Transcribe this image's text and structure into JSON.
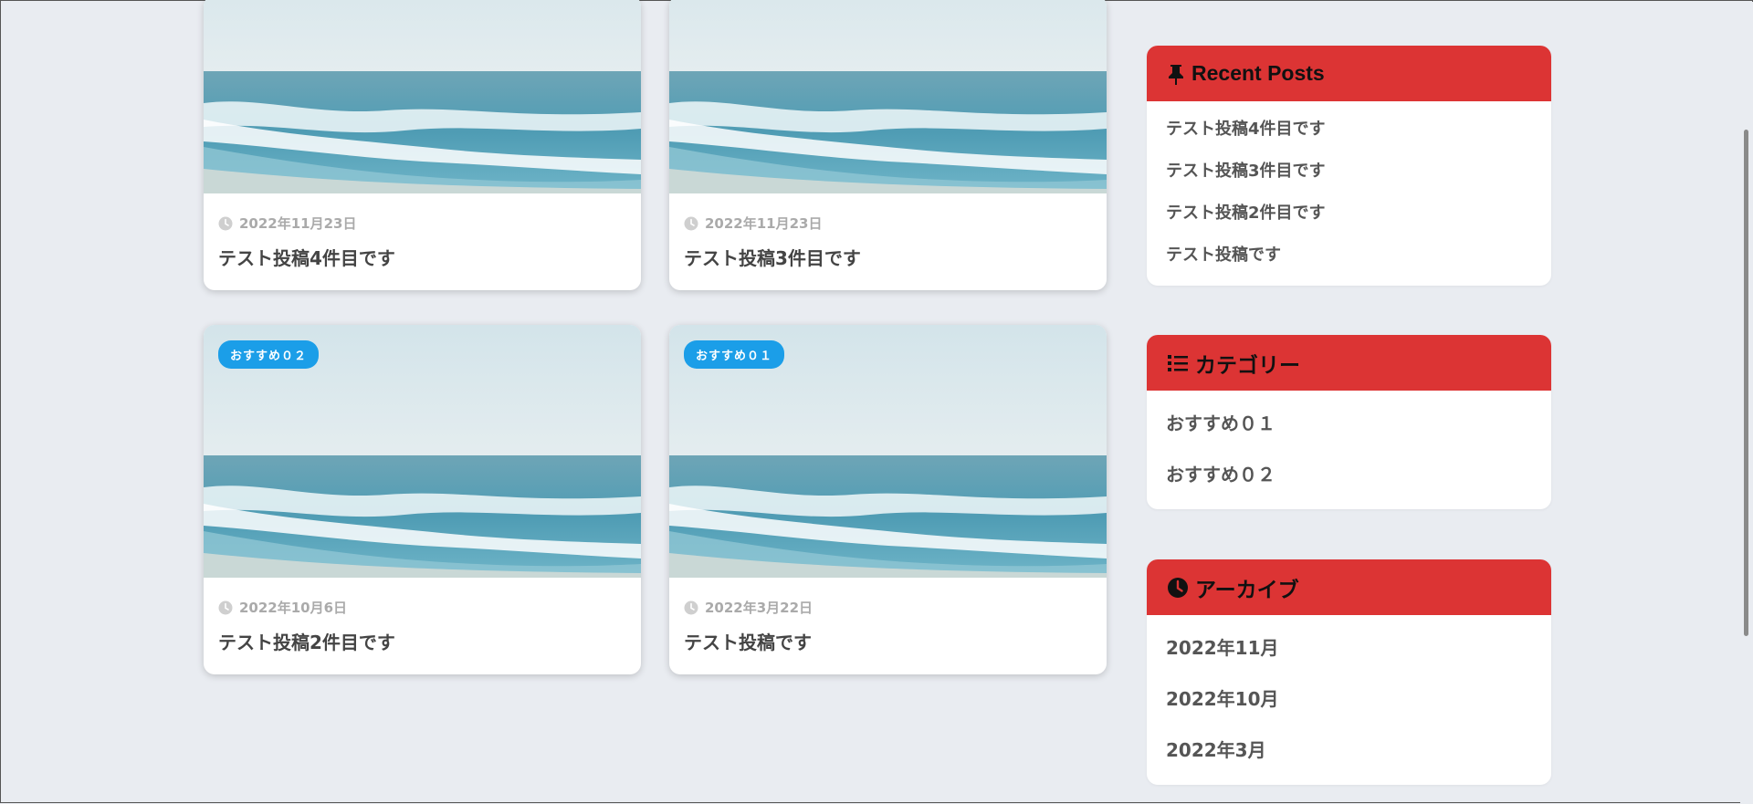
{
  "posts": [
    {
      "date": "2022年11月23日",
      "title": "テスト投稿4件目です",
      "badge": ""
    },
    {
      "date": "2022年11月23日",
      "title": "テスト投稿3件目です",
      "badge": ""
    },
    {
      "date": "2022年10月6日",
      "title": "テスト投稿2件目です",
      "badge": "おすすめ０２"
    },
    {
      "date": "2022年3月22日",
      "title": "テスト投稿です",
      "badge": "おすすめ０１"
    }
  ],
  "sidebar": {
    "recent": {
      "title": "Recent Posts",
      "items": [
        "テスト投稿4件目です",
        "テスト投稿3件目です",
        "テスト投稿2件目です",
        "テスト投稿です"
      ]
    },
    "categories": {
      "title": "カテゴリー",
      "items": [
        "おすすめ０１",
        "おすすめ０２"
      ]
    },
    "archive": {
      "title": "アーカイブ",
      "items": [
        "2022年11月",
        "2022年10月",
        "2022年3月"
      ]
    }
  },
  "colors": {
    "widget_header": "#dc3434",
    "badge": "#1b9ee8",
    "background": "#e9ecf1"
  },
  "icons": {
    "recent": "pin-icon",
    "categories": "list-icon",
    "archive": "clock-icon",
    "post_date": "clock-icon"
  }
}
